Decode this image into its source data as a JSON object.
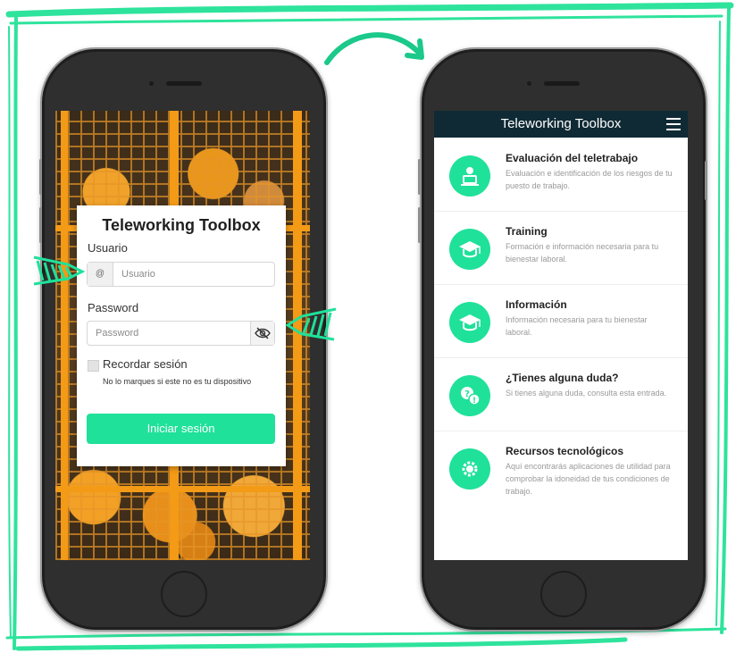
{
  "colors": {
    "accent": "#1fe19a",
    "header": "#0f2a35",
    "frame": "#2ee39c",
    "phone": "#2f2f2f"
  },
  "login": {
    "title": "Teleworking Toolbox",
    "user_label": "Usuario",
    "user_addon": "@",
    "user_placeholder": "Usuario",
    "password_label": "Password",
    "password_placeholder": "Password",
    "remember_label": "Recordar sesión",
    "remember_hint": "No lo marques si este no es tu dispositivo",
    "submit_label": "Iniciar sesión"
  },
  "app": {
    "title": "Teleworking Toolbox",
    "items": [
      {
        "title": "Evaluación del teletrabajo",
        "desc": "Evaluación e identificación de los riesgos de tu puesto de trabajo.",
        "icon": "person-laptop-icon"
      },
      {
        "title": "Training",
        "desc": "Formación e información necesaria para tu bienestar laboral.",
        "icon": "graduation-cap-icon"
      },
      {
        "title": "Información",
        "desc": "Información necesaria para tu bienestar laboral.",
        "icon": "graduation-cap-icon"
      },
      {
        "title": "¿Tienes alguna duda?",
        "desc": "Si tienes alguna duda, consulta esta entrada.",
        "icon": "question-bubbles-icon"
      },
      {
        "title": "Recursos tecnológicos",
        "desc": "Aquí encontrarás aplicaciones de utilidad para comprobar la idoneidad de tus condiciones de trabajo.",
        "icon": "gear-icon"
      }
    ]
  }
}
